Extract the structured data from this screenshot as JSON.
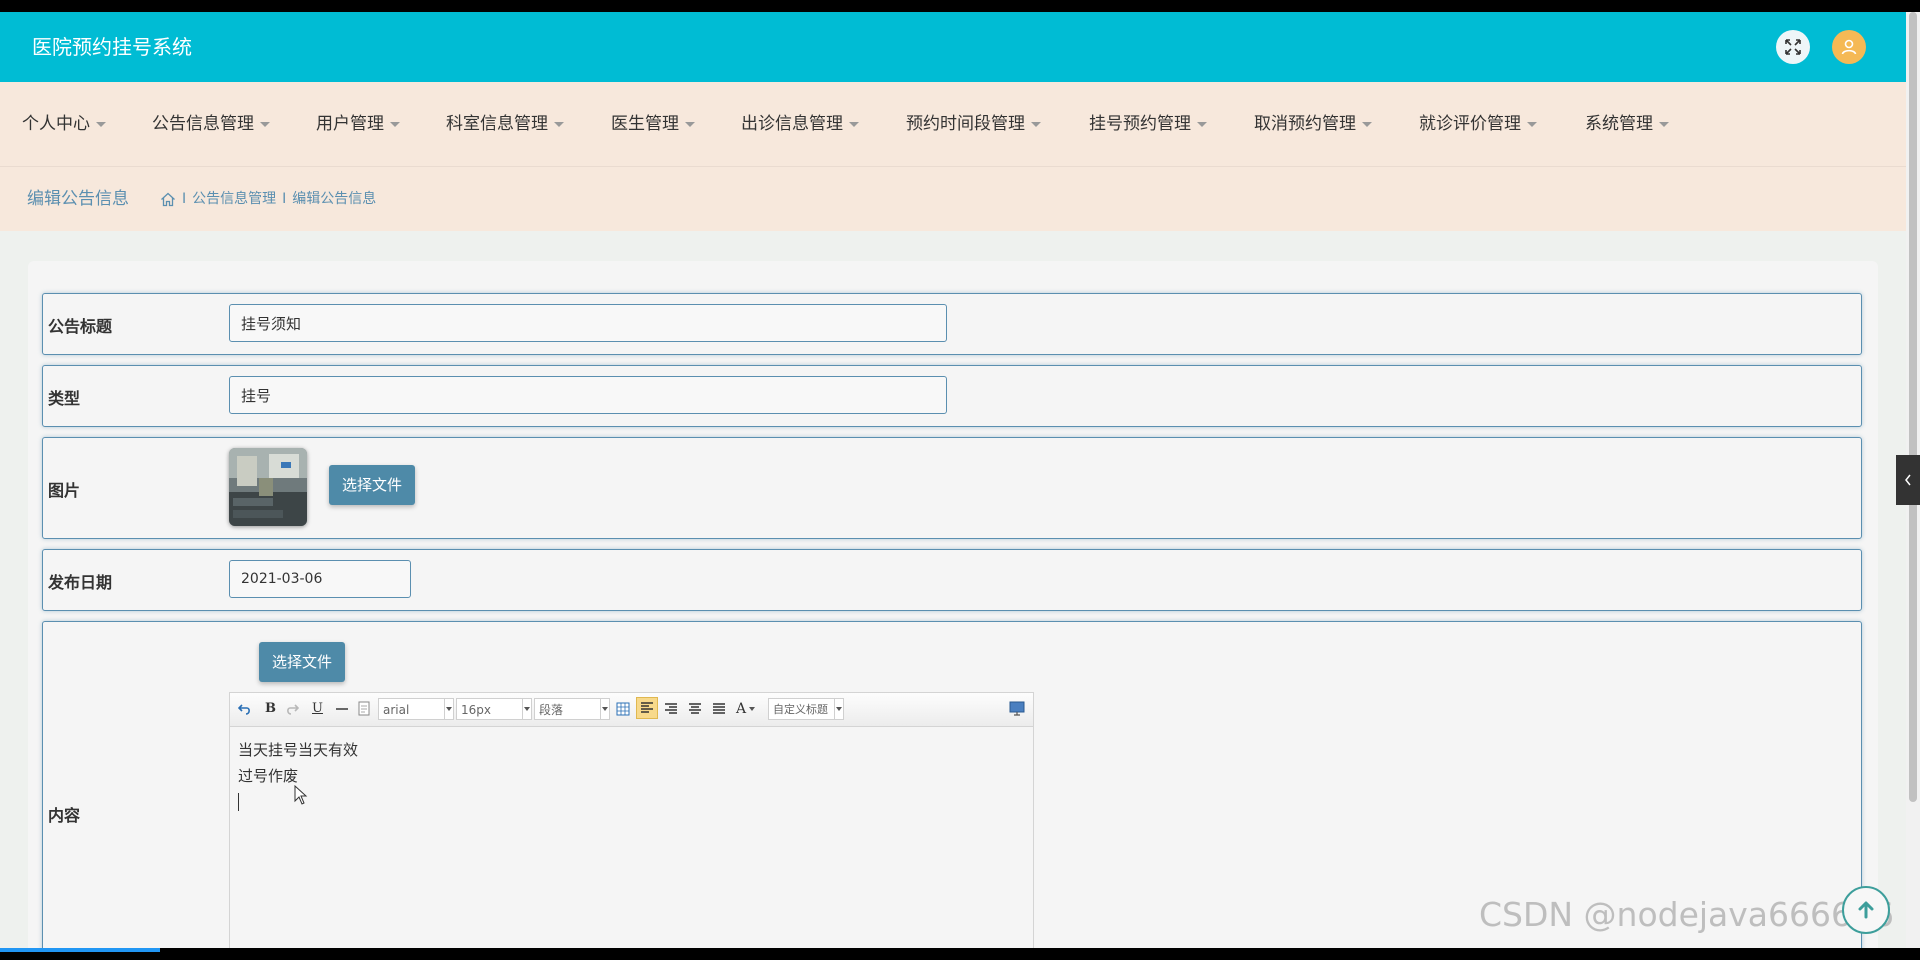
{
  "header": {
    "title": "医院预约挂号系统"
  },
  "nav": {
    "items": [
      {
        "label": "个人中心"
      },
      {
        "label": "公告信息管理"
      },
      {
        "label": "用户管理"
      },
      {
        "label": "科室信息管理"
      },
      {
        "label": "医生管理"
      },
      {
        "label": "出诊信息管理"
      },
      {
        "label": "预约时间段管理"
      },
      {
        "label": "挂号预约管理"
      },
      {
        "label": "取消预约管理"
      },
      {
        "label": "就诊评价管理"
      },
      {
        "label": "系统管理"
      }
    ]
  },
  "breadcrumb": {
    "page_title": "编辑公告信息",
    "sep1": "I",
    "crumb1": "公告信息管理",
    "sep2": "I",
    "crumb2": "编辑公告信息"
  },
  "form": {
    "title_label": "公告标题",
    "title_value": "挂号须知",
    "type_label": "类型",
    "type_value": "挂号",
    "image_label": "图片",
    "image_button": "选择文件",
    "date_label": "发布日期",
    "date_value": "2021-03-06",
    "content_label": "内容",
    "content_button": "选择文件"
  },
  "editor": {
    "font_family": "arial",
    "font_size": "16px",
    "paragraph": "段落",
    "custom_title": "自定义标题",
    "bold": "B",
    "underline": "U",
    "font_color": "A",
    "lines": [
      "当天挂号当天有效",
      "过号作废"
    ]
  },
  "watermark": "CSDN @nodejava666666",
  "colors": {
    "header_bg": "#00bcd4",
    "nav_bg": "#f7e8dc",
    "accent": "#5b8fb0",
    "button": "#4e8aa8"
  }
}
